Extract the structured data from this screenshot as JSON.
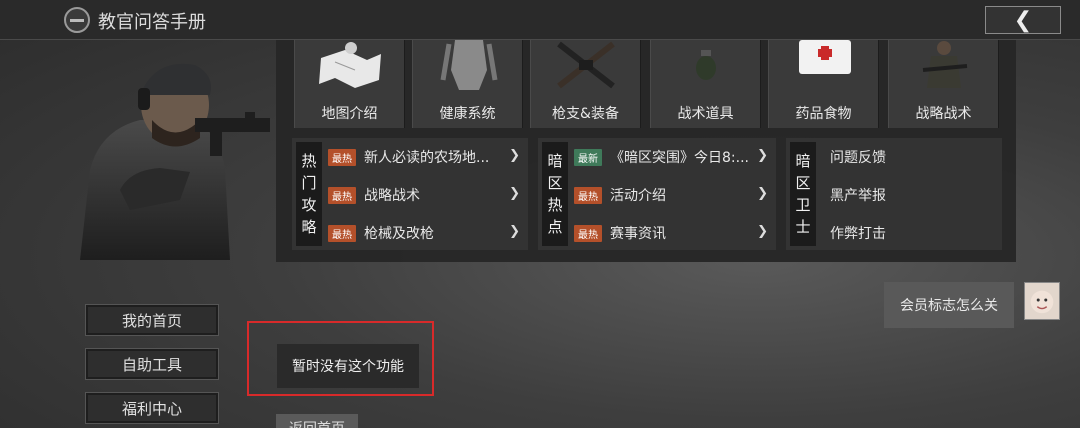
{
  "header": {
    "title": "教官问答手册",
    "back_icon": "chevron-left-icon",
    "back_glyph": "❮"
  },
  "nav": {
    "items": [
      {
        "label": "我的首页"
      },
      {
        "label": "自助工具"
      },
      {
        "label": "福利中心"
      }
    ]
  },
  "categories": [
    {
      "label": "地图介绍",
      "icon": "map-icon"
    },
    {
      "label": "健康系统",
      "icon": "body-icon"
    },
    {
      "label": "枪支&装备",
      "icon": "guns-icon"
    },
    {
      "label": "战术道具",
      "icon": "grenade-icon"
    },
    {
      "label": "药品食物",
      "icon": "medkit-icon"
    },
    {
      "label": "战略战术",
      "icon": "soldier-icon"
    }
  ],
  "groups": [
    {
      "title": "热门攻略",
      "title_chars": [
        "热",
        "门",
        "攻",
        "略"
      ],
      "items": [
        {
          "tag": "最热",
          "tag_type": "hot",
          "text": "新人必读的农场地..."
        },
        {
          "tag": "最热",
          "tag_type": "hot",
          "text": "战略战术"
        },
        {
          "tag": "最热",
          "tag_type": "hot",
          "text": "枪械及改枪"
        }
      ]
    },
    {
      "title": "暗区热点",
      "title_chars": [
        "暗",
        "区",
        "热",
        "点"
      ],
      "items": [
        {
          "tag": "最新",
          "tag_type": "new",
          "text": "《暗区突围》今日8:..."
        },
        {
          "tag": "最热",
          "tag_type": "hot",
          "text": "活动介绍"
        },
        {
          "tag": "最热",
          "tag_type": "hot",
          "text": "赛事资讯"
        }
      ]
    },
    {
      "title": "暗区卫士",
      "title_chars": [
        "暗",
        "区",
        "卫",
        "士"
      ],
      "items": [
        {
          "tag": "",
          "tag_type": "",
          "text": "问题反馈"
        },
        {
          "tag": "",
          "tag_type": "",
          "text": "黑产举报"
        },
        {
          "tag": "",
          "tag_type": "",
          "text": "作弊打击"
        }
      ]
    }
  ],
  "chat": {
    "user_message": "会员标志怎么关",
    "bot_reply": "暂时没有这个功能",
    "return_label": "返回首页"
  },
  "colors": {
    "hot_tag": "#b4502a",
    "new_tag": "#3f7a5a",
    "highlight": "#d82a2a"
  }
}
